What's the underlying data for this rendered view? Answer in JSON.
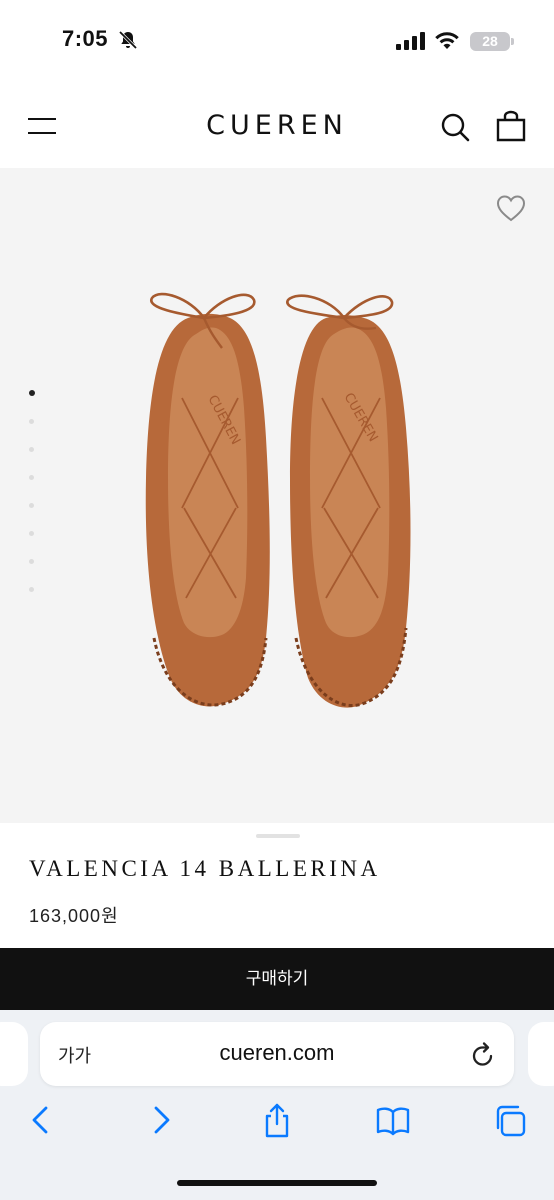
{
  "status_bar": {
    "time": "7:05",
    "battery": "28",
    "bell_icon": "bell-slash-icon",
    "signal_icon": "cellular-signal-icon",
    "wifi_icon": "wifi-icon"
  },
  "header": {
    "logo": "CUEREN",
    "menu_icon": "hamburger-menu-icon",
    "search_icon": "search-icon",
    "bag_icon": "shopping-bag-icon"
  },
  "product": {
    "image_alt": "brown leather ballet flats with laces",
    "wishlist_icon": "heart-icon",
    "gallery_dot_count": 8,
    "active_dot": 0,
    "name": "VALENCIA 14 BALLERINA",
    "price": "163,000원",
    "buy_label": "구매하기",
    "colors": {
      "leather": "#b7693a",
      "lining": "#c98555",
      "background": "#f4f4f4"
    }
  },
  "browser": {
    "text_size_label": "가가",
    "url": "cueren.com",
    "reload_icon": "reload-icon",
    "toolbar": {
      "back_icon": "chevron-left-icon",
      "forward_icon": "chevron-right-icon",
      "share_icon": "share-icon",
      "bookmarks_icon": "book-icon",
      "tabs_icon": "tabs-icon"
    },
    "accent_color": "#0a7aff"
  }
}
